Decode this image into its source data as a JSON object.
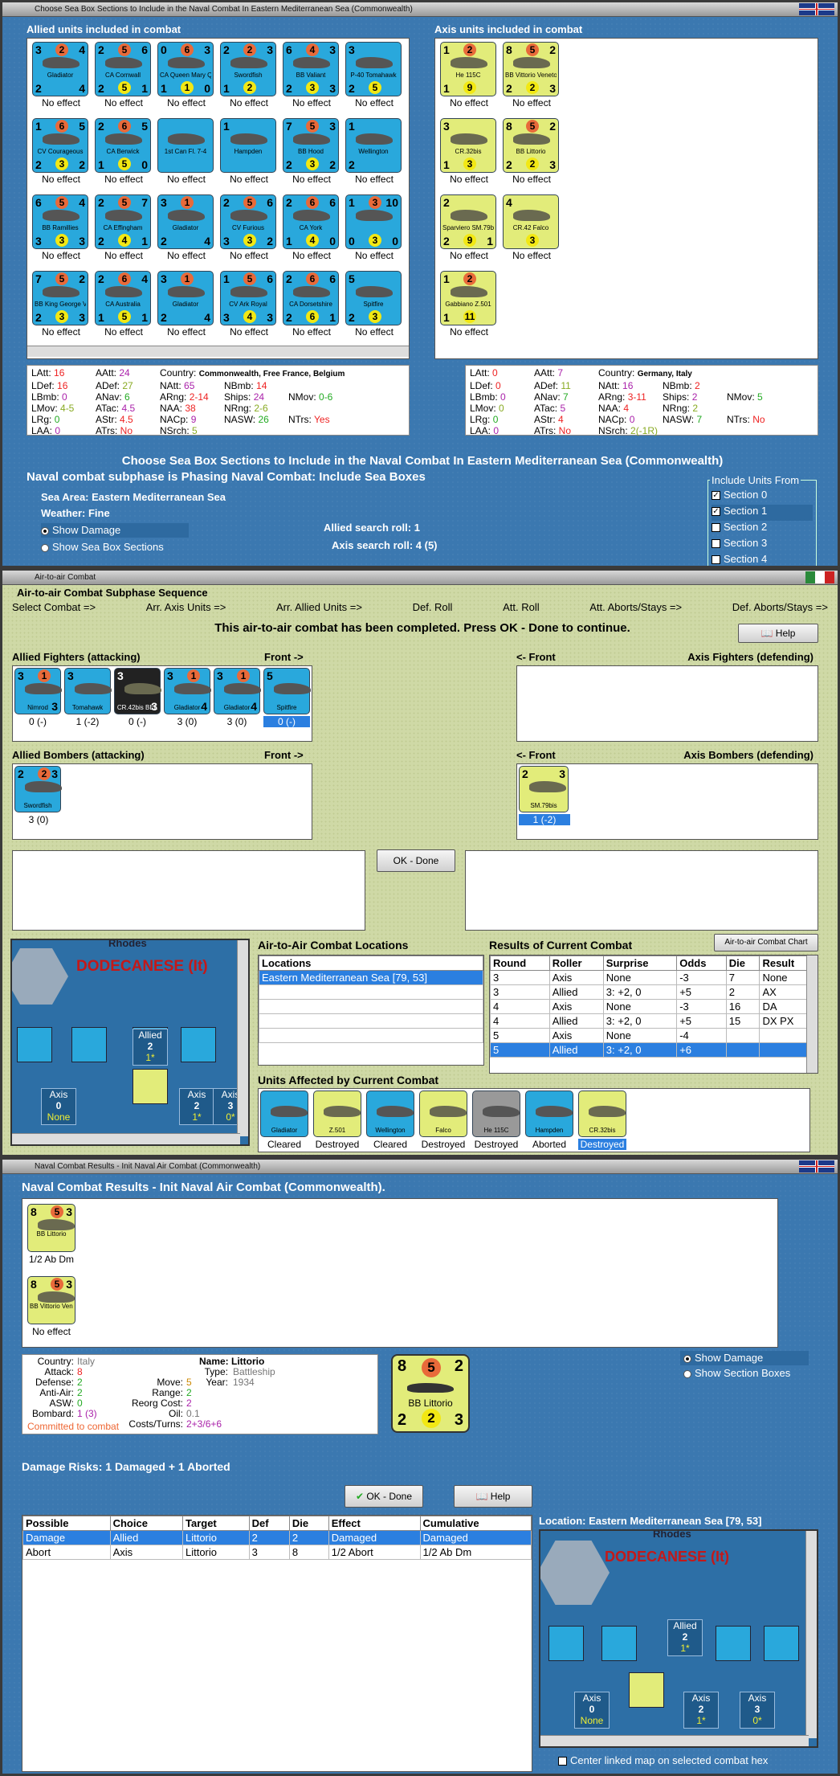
{
  "win1": {
    "title": "Choose Sea Box Sections to Include in the Naval Combat In Eastern Mediterranean Sea (Commonwealth)",
    "allied_header": "Allied units included in combat",
    "axis_header": "Axis units included in combat",
    "allied_units": [
      {
        "tl": "3",
        "tm": "2",
        "tr": "4",
        "bl": "2",
        "bm": "",
        "br": "4",
        "name": "Gladiator",
        "cap": "No effect"
      },
      {
        "tl": "2",
        "tm": "5",
        "tr": "6",
        "bl": "2",
        "bm": "5",
        "br": "1",
        "name": "CA Cornwall",
        "cap": "No effect"
      },
      {
        "tl": "0",
        "tm": "6",
        "tr": "3",
        "bl": "1",
        "bm": "1",
        "br": "0",
        "name": "CA Queen Mary Queen Elizabeth",
        "cap": "No effect"
      },
      {
        "tl": "2",
        "tm": "2",
        "tr": "3",
        "bl": "1",
        "bm": "2",
        "br": "",
        "name": "Swordfish",
        "cap": "No effect"
      },
      {
        "tl": "6",
        "tm": "4",
        "tr": "3",
        "bl": "2",
        "bm": "3",
        "br": "3",
        "name": "BB Valiant",
        "cap": "No effect"
      },
      {
        "tl": "3",
        "tm": "",
        "tr": "",
        "bl": "2",
        "bm": "5",
        "br": "",
        "name": "P-40 Tomahawk",
        "cap": "No effect"
      },
      {
        "tl": "1",
        "tm": "6",
        "tr": "5",
        "bl": "2",
        "bm": "3",
        "br": "2",
        "name": "CV Courageous",
        "cap": "No effect"
      },
      {
        "tl": "2",
        "tm": "6",
        "tr": "5",
        "bl": "1",
        "bm": "5",
        "br": "0",
        "name": "CA Berwick",
        "cap": "No effect"
      },
      {
        "tl": "",
        "tm": "",
        "tr": "",
        "bl": "",
        "bm": "",
        "br": "",
        "name": "1st Can Fl. 7-4",
        "cap": "No effect"
      },
      {
        "tl": "1",
        "tm": "",
        "tr": "",
        "bl": "",
        "bm": "",
        "br": "",
        "name": "Hampden",
        "cap": "No effect"
      },
      {
        "tl": "7",
        "tm": "5",
        "tr": "3",
        "bl": "2",
        "bm": "3",
        "br": "2",
        "name": "BB Hood",
        "cap": "No effect"
      },
      {
        "tl": "1",
        "tm": "",
        "tr": "",
        "bl": "2",
        "bm": "",
        "br": "",
        "name": "Wellington",
        "cap": "No effect"
      },
      {
        "tl": "6",
        "tm": "5",
        "tr": "4",
        "bl": "3",
        "bm": "3",
        "br": "3",
        "name": "BB Ramillies",
        "cap": "No effect"
      },
      {
        "tl": "2",
        "tm": "5",
        "tr": "7",
        "bl": "2",
        "bm": "4",
        "br": "1",
        "name": "CA Effingham",
        "cap": "No effect"
      },
      {
        "tl": "3",
        "tm": "1",
        "tr": "",
        "bl": "2",
        "bm": "",
        "br": "4",
        "name": "Gladiator",
        "cap": "No effect"
      },
      {
        "tl": "2",
        "tm": "5",
        "tr": "6",
        "bl": "3",
        "bm": "3",
        "br": "2",
        "name": "CV Furious",
        "cap": "No effect"
      },
      {
        "tl": "2",
        "tm": "6",
        "tr": "6",
        "bl": "1",
        "bm": "4",
        "br": "0",
        "name": "CA York",
        "cap": "No effect"
      },
      {
        "tl": "1",
        "tm": "3",
        "tr": "10",
        "bl": "0",
        "bm": "3",
        "br": "0",
        "name": "",
        "cap": "No effect"
      },
      {
        "tl": "7",
        "tm": "5",
        "tr": "2",
        "bl": "2",
        "bm": "3",
        "br": "3",
        "name": "BB King George V",
        "cap": "No effect"
      },
      {
        "tl": "2",
        "tm": "6",
        "tr": "4",
        "bl": "1",
        "bm": "5",
        "br": "1",
        "name": "CA Australia",
        "cap": "No effect"
      },
      {
        "tl": "3",
        "tm": "1",
        "tr": "",
        "bl": "2",
        "bm": "",
        "br": "4",
        "name": "Gladiator",
        "cap": "No effect"
      },
      {
        "tl": "1",
        "tm": "5",
        "tr": "6",
        "bl": "3",
        "bm": "4",
        "br": "3",
        "name": "CV Ark Royal",
        "cap": "No effect"
      },
      {
        "tl": "2",
        "tm": "6",
        "tr": "6",
        "bl": "2",
        "bm": "6",
        "br": "1",
        "name": "CA Dorsetshire",
        "cap": "No effect"
      },
      {
        "tl": "5",
        "tm": "",
        "tr": "",
        "bl": "2",
        "bm": "3",
        "br": "",
        "name": "Spitfire",
        "cap": "No effect"
      }
    ],
    "axis_units": [
      {
        "tl": "1",
        "tm": "2",
        "tr": "",
        "bl": "1",
        "bm": "9",
        "br": "",
        "name": "He 115C",
        "cap": "No effect"
      },
      {
        "tl": "8",
        "tm": "5",
        "tr": "2",
        "bl": "2",
        "bm": "2",
        "br": "3",
        "name": "BB Vittorio Veneto",
        "cap": "No effect"
      },
      {
        "tl": "3",
        "tm": "",
        "tr": "",
        "bl": "1",
        "bm": "3",
        "br": "",
        "name": "CR.32bis",
        "cap": "No effect"
      },
      {
        "tl": "8",
        "tm": "5",
        "tr": "2",
        "bl": "2",
        "bm": "2",
        "br": "3",
        "name": "BB Littorio",
        "cap": "No effect"
      },
      {
        "tl": "2",
        "tm": "",
        "tr": "",
        "bl": "2",
        "bm": "9",
        "br": "1",
        "name": "Sparviero SM.79bis",
        "cap": "No effect"
      },
      {
        "tl": "4",
        "tm": "",
        "tr": "",
        "bl": "",
        "bm": "3",
        "br": "",
        "name": "CR.42 Falco",
        "cap": "No effect"
      },
      {
        "tl": "1",
        "tm": "2",
        "tr": "",
        "bl": "1",
        "bm": "11",
        "br": "",
        "name": "Gabbiano Z.501",
        "cap": "No effect"
      }
    ],
    "allied_stats": [
      [
        "LAtt:",
        "16",
        "AAtt:",
        "24",
        "Country:",
        "Commonwealth, Free France, Belgium"
      ],
      [
        "LDef:",
        "16",
        "ADef:",
        "27",
        "NAtt:",
        "65",
        "NBmb:",
        "14"
      ],
      [
        "LBmb:",
        "0",
        "ANav:",
        "6",
        "ARng:",
        "2-14",
        "Ships:",
        "24",
        "NMov:",
        "0-6"
      ],
      [
        "LMov:",
        "4-5",
        "ATac:",
        "4.5",
        "NAA:",
        "38",
        "NRng:",
        "2-6"
      ],
      [
        "LRg:",
        "0",
        "AStr:",
        "4.5",
        "NACp:",
        "9",
        "NASW:",
        "26",
        "NTrs:",
        "Yes"
      ],
      [
        "LAA:",
        "0",
        "ATrs:",
        "No",
        "NSrch:",
        "5"
      ]
    ],
    "axis_stats": [
      [
        "LAtt:",
        "0",
        "AAtt:",
        "7",
        "Country:",
        "Germany, Italy"
      ],
      [
        "LDef:",
        "0",
        "ADef:",
        "11",
        "NAtt:",
        "16",
        "NBmb:",
        "2"
      ],
      [
        "LBmb:",
        "0",
        "ANav:",
        "7",
        "ARng:",
        "3-11",
        "Ships:",
        "2",
        "NMov:",
        "5"
      ],
      [
        "LMov:",
        "0",
        "ATac:",
        "5",
        "NAA:",
        "4",
        "NRng:",
        "2"
      ],
      [
        "LRg:",
        "0",
        "AStr:",
        "4",
        "NACp:",
        "0",
        "NASW:",
        "7",
        "NTrs:",
        "No"
      ],
      [
        "LAA:",
        "0",
        "ATrs:",
        "No",
        "NSrch:",
        "2(-1R)"
      ]
    ],
    "title_big": "Choose Sea Box Sections to Include in the Naval Combat In Eastern Mediterranean Sea (Commonwealth)",
    "subphase": "Naval combat subphase is Phasing Naval Combat: Include Sea Boxes",
    "sea_area": "Sea Area:  Eastern Mediterranean Sea",
    "weather": "Weather:  Fine",
    "show_damage": "Show Damage",
    "show_sections": "Show Sea Box Sections",
    "allied_roll": "Allied search roll:  1",
    "axis_roll": "Axis search roll:  4 (5)",
    "include_title": "Include Units From",
    "sections": [
      {
        "label": "Section 0",
        "checked": "✓"
      },
      {
        "label": "Section 1",
        "checked": "✓"
      },
      {
        "label": "Section 2",
        "checked": ""
      },
      {
        "label": "Section 3",
        "checked": ""
      },
      {
        "label": "Section 4",
        "checked": ""
      }
    ]
  },
  "win2": {
    "title": "Air-to-air Combat",
    "seq_title": "Air-to-air Combat Subphase Sequence",
    "steps": [
      "Select Combat =>",
      "Arr. Axis Units =>",
      "Arr. Allied Units =>",
      "Def. Roll",
      "Att. Roll",
      "Att. Aborts/Stays =>",
      "Def. Aborts/Stays =>"
    ],
    "message": "This air-to-air combat has been completed.  Press OK - Done to continue.",
    "help": "Help",
    "allied_fighters": "Allied Fighters (attacking)",
    "front": "Front ->",
    "front_l": "<- Front",
    "axis_fighters": "Axis Fighters (defending)",
    "allied_bombers": "Allied Bombers (attacking)",
    "axis_bombers": "Axis Bombers (defending)",
    "fighters": [
      {
        "name": "Nimrod",
        "cap": "0 (-)",
        "tl": "3",
        "tm": "1",
        "br": "3"
      },
      {
        "name": "Tomahawk",
        "cap": "1 (-2)",
        "tl": "3",
        "tm": "",
        "br": ""
      },
      {
        "name": "CR.42bis BEL",
        "cap": "0 (-)",
        "tl": "3",
        "tm": "",
        "br": "3"
      },
      {
        "name": "Gladiator",
        "cap": "3 (0)",
        "tl": "3",
        "tm": "1",
        "br": "4"
      },
      {
        "name": "Gladiator",
        "cap": "3 (0)",
        "tl": "3",
        "tm": "1",
        "br": "4"
      },
      {
        "name": "Spitfire",
        "cap": "0 (-)",
        "tl": "5",
        "tm": "",
        "br": ""
      }
    ],
    "bomber": {
      "name": "Swordfish",
      "cap": "3 (0)",
      "tl": "2",
      "tm": "2",
      "br": "3"
    },
    "axis_bomber": {
      "name": "SM.79bis",
      "cap": "1 (-2)",
      "tl": "2",
      "tm": "",
      "br": "3"
    },
    "ok": "OK - Done",
    "map_title": "DODECANESE (It)",
    "rhodes": "Rhodes",
    "map_boxes": [
      {
        "l": "Axis",
        "v": "0",
        "s": "None"
      },
      {
        "l": "Axis",
        "v": "2",
        "s": "1*"
      },
      {
        "l": "Axis",
        "v": "3",
        "s": "0*"
      }
    ],
    "allied_box": {
      "l": "Allied",
      "v": "2",
      "s": "1*"
    },
    "loc_title": "Air-to-Air Combat Locations",
    "loc_header": "Locations",
    "loc_row": "Eastern Mediterranean Sea [79, 53]",
    "res_title": "Results of Current Combat",
    "chart_btn": "Air-to-air Combat Chart",
    "res_headers": [
      "Round",
      "Roller",
      "Surprise",
      "Odds",
      "Die",
      "Result"
    ],
    "res_rows": [
      [
        "3",
        "Axis",
        "None",
        "-3",
        "7",
        "None"
      ],
      [
        "3",
        "Allied",
        "3: +2, 0",
        "+5",
        "2",
        "AX"
      ],
      [
        "4",
        "Axis",
        "None",
        "-3",
        "16",
        "DA"
      ],
      [
        "4",
        "Allied",
        "3: +2, 0",
        "+5",
        "15",
        "DX PX"
      ],
      [
        "5",
        "Axis",
        "None",
        "-4",
        "",
        ""
      ],
      [
        "5",
        "Allied",
        "3: +2, 0",
        "+6",
        "",
        ""
      ]
    ],
    "aff_title": "Units Affected by Current Combat",
    "affected": [
      {
        "name": "Gladiator",
        "cap": "Cleared"
      },
      {
        "name": "Z.501",
        "cap": "Destroyed"
      },
      {
        "name": "Wellington",
        "cap": "Cleared"
      },
      {
        "name": "Falco",
        "cap": "Destroyed"
      },
      {
        "name": "He 115C",
        "cap": "Destroyed"
      },
      {
        "name": "Hampden",
        "cap": "Aborted"
      },
      {
        "name": "CR.32bis",
        "cap": "Destroyed"
      }
    ]
  },
  "win3": {
    "title": "Naval Combat Results - Init Naval Air Combat (Commonwealth)",
    "heading": "Naval Combat Results - Init Naval Air Combat (Commonwealth).",
    "units": [
      {
        "name": "BB Littorio",
        "cap": "1/2 Ab Dm"
      },
      {
        "name": "BB Vittorio Veneto",
        "cap": "No effect"
      }
    ],
    "info": {
      "country": "Italy",
      "attack": "8",
      "defense": "2",
      "anti_air": "2",
      "asw": "0",
      "bombard": "1 (3)",
      "move": "5",
      "range": "2",
      "reorg": "2",
      "oil": "0.1",
      "costs": "2+3/6+6",
      "name": "Littorio",
      "type": "Battleship",
      "year": "1934",
      "committed": "Committed to combat"
    },
    "big_unit": {
      "tl": "8",
      "tm": "5",
      "tr": "2",
      "bl": "2",
      "bm": "2",
      "br": "3",
      "name": "BB Littorio"
    },
    "show_damage": "Show Damage",
    "show_sections": "Show Section Boxes",
    "risks": "Damage Risks:  1 Damaged + 1 Aborted",
    "ok": "OK - Done",
    "help": "Help",
    "headers": [
      "Possible",
      "Choice",
      "Target",
      "Def",
      "Die",
      "Effect",
      "Cumulative"
    ],
    "rows": [
      [
        "Damage",
        "Allied",
        "Littorio",
        "2",
        "2",
        "Damaged",
        "Damaged"
      ],
      [
        "Abort",
        "Axis",
        "Littorio",
        "3",
        "8",
        "1/2 Abort",
        "1/2 Ab Dm"
      ]
    ],
    "location": "Location:  Eastern Mediterranean Sea [79, 53]",
    "center": "Center linked map on selected combat hex"
  },
  "colors": {
    "allied": "#29a8dc",
    "axis": "#e2ec7a",
    "selection": "#2b7fe0"
  }
}
